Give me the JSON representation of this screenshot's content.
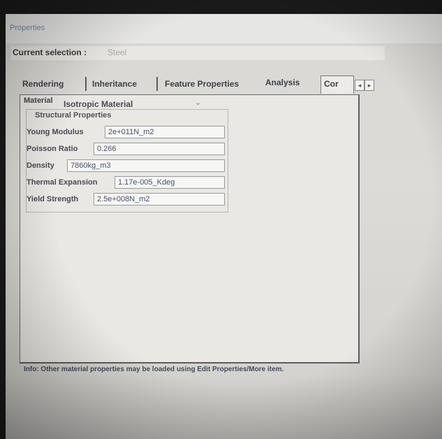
{
  "window": {
    "title": "Properties"
  },
  "selection": {
    "label": "Current selection :",
    "value": "Steel"
  },
  "tabs": [
    "Rendering",
    "Inheritance",
    "Feature Properties",
    "Analysis",
    "Cor"
  ],
  "active_tab": "Analysis",
  "material": {
    "label": "Material",
    "value": "Isotropic Material"
  },
  "structural": {
    "title": "Structural Properties",
    "rows": [
      {
        "label": "Young Modulus",
        "value": "2e+011N_m2"
      },
      {
        "label": "Poisson Ratio",
        "value": "0.266"
      },
      {
        "label": "Density",
        "value": "7860kg_m3"
      },
      {
        "label": "Thermal Expansion",
        "value": "1.17e-005_Kdeg"
      },
      {
        "label": "Yield Strength",
        "value": "2.5e+008N_m2"
      }
    ]
  },
  "info": "Info: Other material properties may be loaded using Edit Properties/More item."
}
